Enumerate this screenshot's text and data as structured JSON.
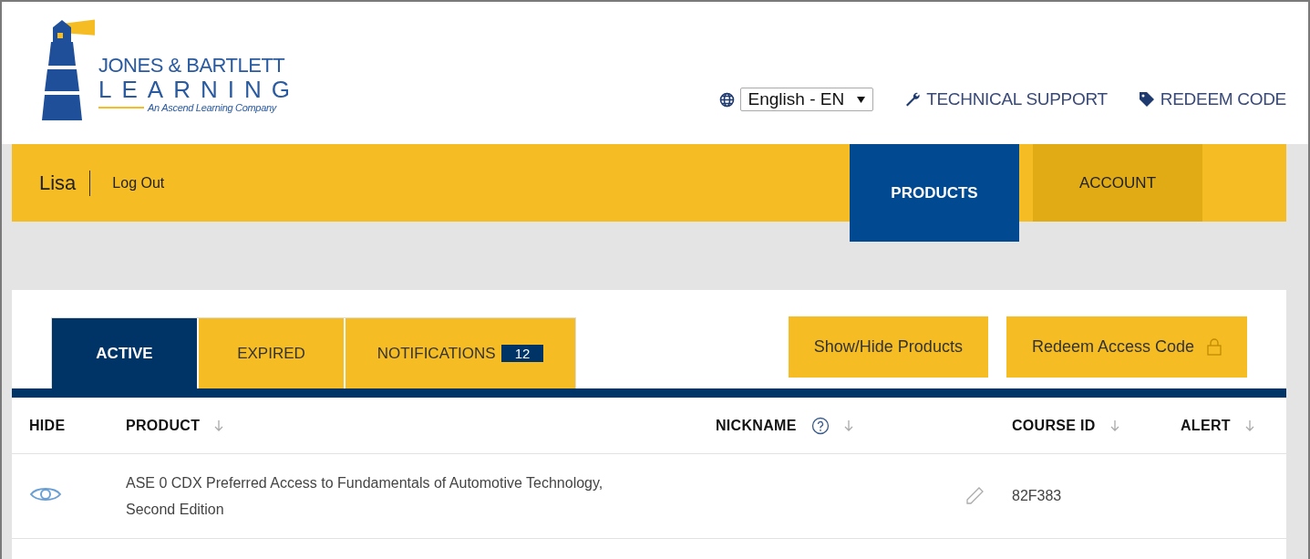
{
  "logo": {
    "line_1": "JONES & BARTLETT",
    "line_2": "LEARNING",
    "tagline": "An Ascend Learning Company"
  },
  "language": {
    "value": "English - EN"
  },
  "links": [
    {
      "kind": "support",
      "label": "TECHNICAL SUPPORT"
    },
    {
      "kind": "redeem",
      "label": "REDEEM CODE"
    }
  ],
  "user": {
    "name": "Lisa",
    "logout": "Log Out"
  },
  "nav": [
    {
      "label": "PRODUCTS",
      "selected": true
    },
    {
      "label": "ACCOUNT",
      "selected": false
    }
  ],
  "tabs": [
    {
      "label": "ACTIVE",
      "selected": true
    },
    {
      "label": "EXPIRED",
      "selected": false
    },
    {
      "label": "NOTIFICATIONS",
      "selected": false,
      "badge": "12"
    }
  ],
  "buttons": [
    {
      "label": "Show/Hide Products",
      "kind": "plain"
    },
    {
      "label": "Redeem Access Code",
      "kind": "locked"
    }
  ],
  "table": {
    "columns": [
      {
        "label": "HIDE",
        "sortable": false,
        "help": false
      },
      {
        "label": "PRODUCT",
        "sortable": true,
        "help": false
      },
      {
        "label": "NICKNAME",
        "sortable": true,
        "help": true
      },
      {
        "label": "COURSE ID",
        "sortable": true,
        "help": false
      },
      {
        "label": "ALERT",
        "sortable": true,
        "help": false
      }
    ],
    "rows": [
      {
        "product": "ASE 0 CDX Preferred Access to Fundamentals of Automotive Technology, Second Edition",
        "course_id": "82F383"
      }
    ]
  }
}
